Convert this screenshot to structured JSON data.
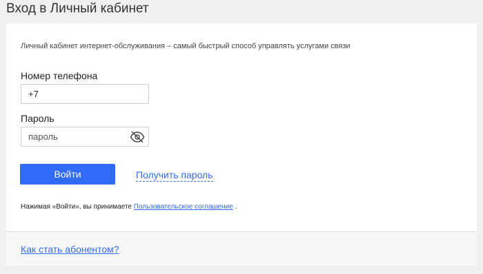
{
  "page": {
    "title": "Вход в Личный кабинет"
  },
  "form": {
    "subtitle": "Личный кабинет интернет-обслуживания – самый быстрый способ управлять услугами связи",
    "phone": {
      "label": "Номер телефона",
      "value": "+7"
    },
    "password": {
      "label": "Пароль",
      "placeholder": "пароль",
      "toggle_icon": "eye-slash-icon"
    },
    "login_button": "Войти",
    "get_password_link": "Получить пароль",
    "agreement": {
      "prefix": "Нажимая «Войти», вы принимаете",
      "link": "Пользовательское соглашение",
      "suffix": "."
    }
  },
  "footer": {
    "become_subscriber_link": "Как стать абонентом?"
  },
  "colors": {
    "accent": "#2f6bf7",
    "background": "#f0f0f0",
    "card": "#ffffff"
  }
}
